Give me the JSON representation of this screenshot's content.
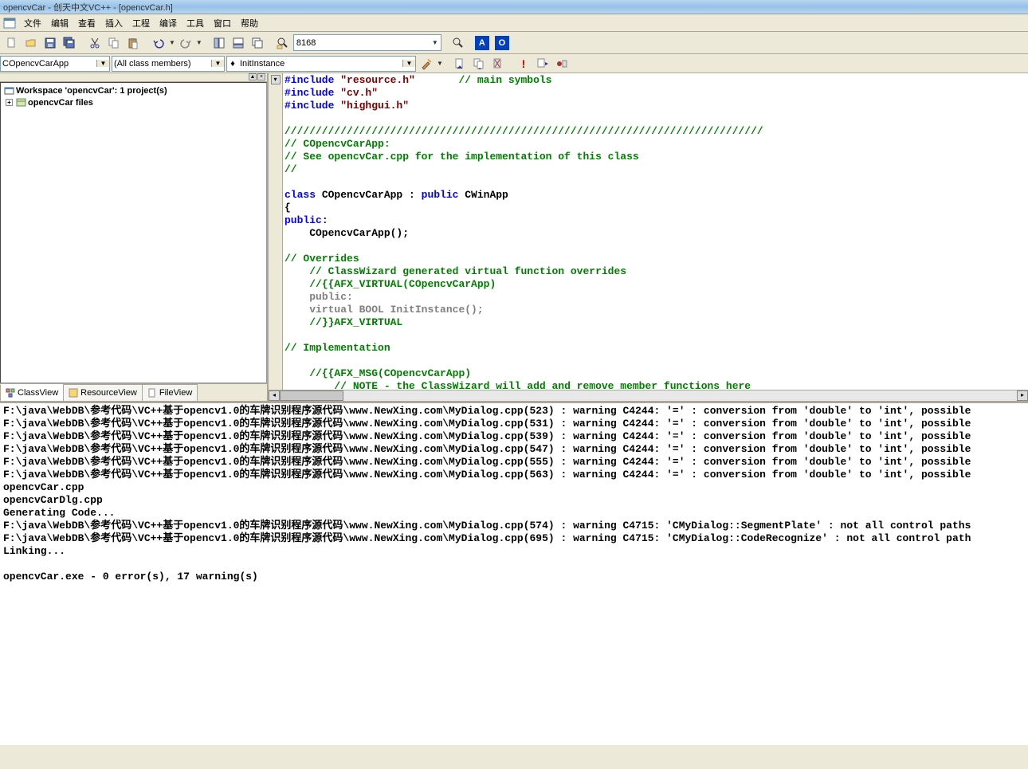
{
  "title": "opencvCar - 创天中文VC++ - [opencvCar.h]",
  "menu": [
    "文件",
    "编辑",
    "查看",
    "插入",
    "工程",
    "编译",
    "工具",
    "窗口",
    "帮助"
  ],
  "toolbar": {
    "find_value": "8168",
    "indicator_a": "A",
    "indicator_o": "O"
  },
  "secondbar": {
    "class_combo": "COpencvCarApp",
    "member_combo": "(All class members)",
    "func_combo": "InitInstance"
  },
  "workspace": {
    "root": "Workspace 'opencvCar': 1 project(s)",
    "project": "opencvCar files"
  },
  "sidebar_tabs": {
    "class": "ClassView",
    "resource": "ResourceView",
    "file": "FileView"
  },
  "code_lines": [
    {
      "pre": "",
      "parts": [
        {
          "t": "#include ",
          "c": "kw"
        },
        {
          "t": "\"resource.h\"",
          "c": "str"
        },
        {
          "t": "       ",
          "c": ""
        },
        {
          "t": "// main symbols",
          "c": "cm"
        }
      ]
    },
    {
      "pre": "",
      "parts": [
        {
          "t": "#include ",
          "c": "kw"
        },
        {
          "t": "\"cv.h\"",
          "c": "str"
        }
      ]
    },
    {
      "pre": "",
      "parts": [
        {
          "t": "#include ",
          "c": "kw"
        },
        {
          "t": "\"highgui.h\"",
          "c": "str"
        }
      ]
    },
    {
      "pre": "",
      "parts": []
    },
    {
      "pre": "",
      "parts": [
        {
          "t": "/////////////////////////////////////////////////////////////////////////////",
          "c": "cm"
        }
      ]
    },
    {
      "pre": "",
      "parts": [
        {
          "t": "// COpencvCarApp:",
          "c": "cm"
        }
      ]
    },
    {
      "pre": "",
      "parts": [
        {
          "t": "// See opencvCar.cpp for the implementation of this class",
          "c": "cm"
        }
      ]
    },
    {
      "pre": "",
      "parts": [
        {
          "t": "//",
          "c": "cm"
        }
      ]
    },
    {
      "pre": "",
      "parts": []
    },
    {
      "pre": "",
      "parts": [
        {
          "t": "class",
          "c": "kw"
        },
        {
          "t": " COpencvCarApp : ",
          "c": ""
        },
        {
          "t": "public",
          "c": "kw"
        },
        {
          "t": " CWinApp",
          "c": ""
        }
      ]
    },
    {
      "pre": "",
      "parts": [
        {
          "t": "{",
          "c": ""
        }
      ]
    },
    {
      "pre": "",
      "parts": [
        {
          "t": "public",
          "c": "kw"
        },
        {
          "t": ":",
          "c": ""
        }
      ]
    },
    {
      "pre": "    ",
      "parts": [
        {
          "t": "COpencvCarApp();",
          "c": ""
        }
      ]
    },
    {
      "pre": "",
      "parts": []
    },
    {
      "pre": "",
      "parts": [
        {
          "t": "// Overrides",
          "c": "cm"
        }
      ]
    },
    {
      "pre": "    ",
      "parts": [
        {
          "t": "// ClassWizard generated virtual function overrides",
          "c": "cm"
        }
      ]
    },
    {
      "pre": "    ",
      "parts": [
        {
          "t": "//{{AFX_VIRTUAL(COpencvCarApp)",
          "c": "cm"
        }
      ]
    },
    {
      "pre": "    ",
      "parts": [
        {
          "t": "public:",
          "c": "gray"
        }
      ]
    },
    {
      "pre": "    ",
      "parts": [
        {
          "t": "virtual BOOL InitInstance();",
          "c": "gray"
        }
      ]
    },
    {
      "pre": "    ",
      "parts": [
        {
          "t": "//}}AFX_VIRTUAL",
          "c": "cm"
        }
      ]
    },
    {
      "pre": "",
      "parts": []
    },
    {
      "pre": "",
      "parts": [
        {
          "t": "// Implementation",
          "c": "cm"
        }
      ]
    },
    {
      "pre": "",
      "parts": []
    },
    {
      "pre": "    ",
      "parts": [
        {
          "t": "//{{AFX_MSG(COpencvCarApp)",
          "c": "cm"
        }
      ]
    },
    {
      "pre": "        ",
      "parts": [
        {
          "t": "// NOTE - the ClassWizard will add and remove member functions here",
          "c": "cm"
        }
      ]
    }
  ],
  "output_lines": [
    "F:\\java\\WebDB\\参考代码\\VC++基于opencv1.0的车牌识别程序源代码\\www.NewXing.com\\MyDialog.cpp(523) : warning C4244: '=' : conversion from 'double' to 'int', possible",
    "F:\\java\\WebDB\\参考代码\\VC++基于opencv1.0的车牌识别程序源代码\\www.NewXing.com\\MyDialog.cpp(531) : warning C4244: '=' : conversion from 'double' to 'int', possible",
    "F:\\java\\WebDB\\参考代码\\VC++基于opencv1.0的车牌识别程序源代码\\www.NewXing.com\\MyDialog.cpp(539) : warning C4244: '=' : conversion from 'double' to 'int', possible",
    "F:\\java\\WebDB\\参考代码\\VC++基于opencv1.0的车牌识别程序源代码\\www.NewXing.com\\MyDialog.cpp(547) : warning C4244: '=' : conversion from 'double' to 'int', possible",
    "F:\\java\\WebDB\\参考代码\\VC++基于opencv1.0的车牌识别程序源代码\\www.NewXing.com\\MyDialog.cpp(555) : warning C4244: '=' : conversion from 'double' to 'int', possible",
    "F:\\java\\WebDB\\参考代码\\VC++基于opencv1.0的车牌识别程序源代码\\www.NewXing.com\\MyDialog.cpp(563) : warning C4244: '=' : conversion from 'double' to 'int', possible",
    "opencvCar.cpp",
    "opencvCarDlg.cpp",
    "Generating Code...",
    "F:\\java\\WebDB\\参考代码\\VC++基于opencv1.0的车牌识别程序源代码\\www.NewXing.com\\MyDialog.cpp(574) : warning C4715: 'CMyDialog::SegmentPlate' : not all control paths",
    "F:\\java\\WebDB\\参考代码\\VC++基于opencv1.0的车牌识别程序源代码\\www.NewXing.com\\MyDialog.cpp(695) : warning C4715: 'CMyDialog::CodeRecognize' : not all control path",
    "Linking...",
    "",
    "opencvCar.exe - 0 error(s), 17 warning(s)"
  ]
}
